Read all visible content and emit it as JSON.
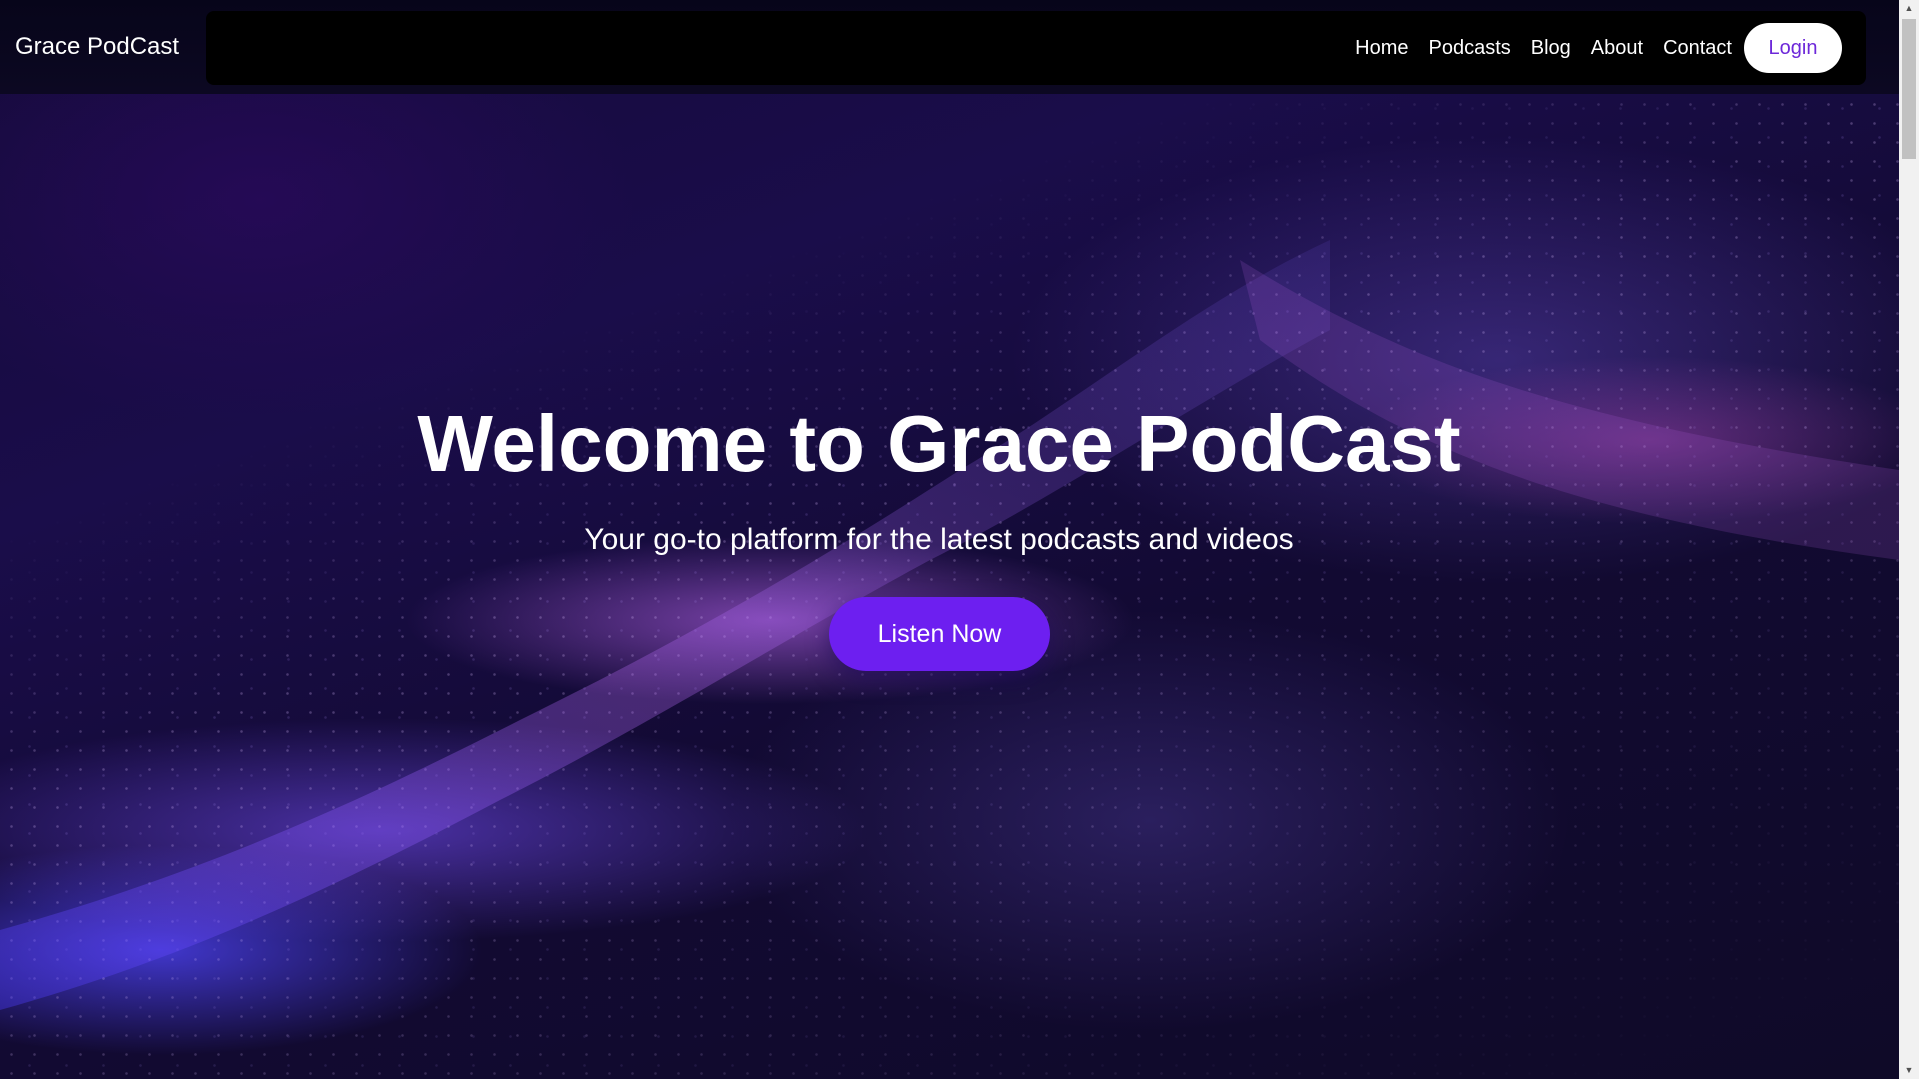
{
  "brand": {
    "name": "Grace PodCast"
  },
  "nav": {
    "links": [
      "Home",
      "Podcasts",
      "Blog",
      "About",
      "Contact"
    ],
    "login_label": "Login"
  },
  "hero": {
    "title": "Welcome to Grace PodCast",
    "subtitle": "Your go-to platform for the latest podcasts and videos",
    "cta_label": "Listen Now"
  },
  "colors": {
    "accent": "#6d1ff0",
    "login_text": "#6d28d9",
    "nav_background": "#000000"
  },
  "icons": {
    "scroll_up": "scroll-up-arrow-icon",
    "scroll_down": "scroll-down-arrow-icon"
  }
}
